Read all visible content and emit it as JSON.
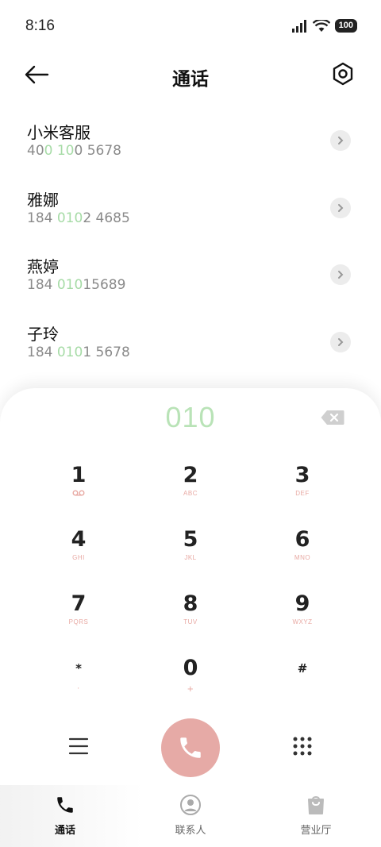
{
  "status": {
    "time": "8:16",
    "battery": "100"
  },
  "header": {
    "title": "通话"
  },
  "contacts": [
    {
      "name": "小米客服",
      "number_parts": [
        "40",
        "0 10",
        "0 5678"
      ]
    },
    {
      "name": "雅娜",
      "number_parts": [
        "184 ",
        "010",
        "2 4685"
      ]
    },
    {
      "name": "燕婷",
      "number_parts": [
        "184 ",
        "010",
        "15689"
      ]
    },
    {
      "name": "子玲",
      "number_parts": [
        "184 ",
        "010",
        "1 5678"
      ]
    }
  ],
  "dialer": {
    "input": "010",
    "keys": [
      {
        "digit": "1",
        "sub": "voicemail"
      },
      {
        "digit": "2",
        "sub": "ABC"
      },
      {
        "digit": "3",
        "sub": "DEF"
      },
      {
        "digit": "4",
        "sub": "GHI"
      },
      {
        "digit": "5",
        "sub": "JKL"
      },
      {
        "digit": "6",
        "sub": "MNO"
      },
      {
        "digit": "7",
        "sub": "PQRS"
      },
      {
        "digit": "8",
        "sub": "TUV"
      },
      {
        "digit": "9",
        "sub": "WXYZ"
      },
      {
        "digit": "*",
        "sub": ","
      },
      {
        "digit": "0",
        "sub": "+"
      },
      {
        "digit": "#",
        "sub": ""
      }
    ]
  },
  "bottom_nav": [
    {
      "label": "通话",
      "icon": "phone-icon",
      "active": true
    },
    {
      "label": "联系人",
      "icon": "person-icon",
      "active": false
    },
    {
      "label": "营业厅",
      "icon": "shopping-bag-icon",
      "active": false
    }
  ],
  "colors": {
    "highlight": "#a6dba6",
    "call_button": "#e6aaa6",
    "key_sub": "#e8a9a3"
  }
}
